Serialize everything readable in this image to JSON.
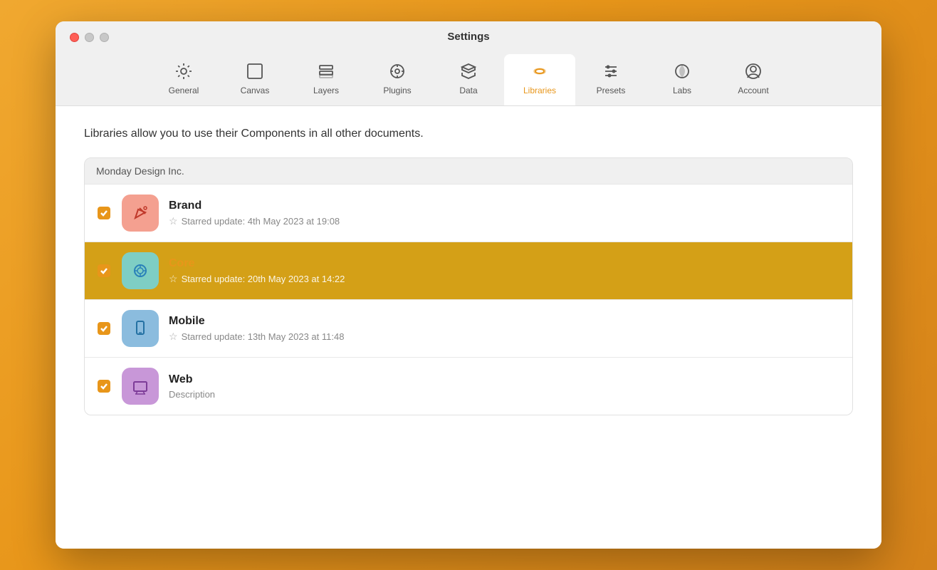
{
  "window": {
    "title": "Settings"
  },
  "nav": {
    "tabs": [
      {
        "id": "general",
        "label": "General",
        "icon": "gear"
      },
      {
        "id": "canvas",
        "label": "Canvas",
        "icon": "canvas"
      },
      {
        "id": "layers",
        "label": "Layers",
        "icon": "layers"
      },
      {
        "id": "plugins",
        "label": "Plugins",
        "icon": "plugins"
      },
      {
        "id": "data",
        "label": "Data",
        "icon": "data"
      },
      {
        "id": "libraries",
        "label": "Libraries",
        "icon": "libraries",
        "active": true
      },
      {
        "id": "presets",
        "label": "Presets",
        "icon": "presets"
      },
      {
        "id": "labs",
        "label": "Labs",
        "icon": "labs"
      },
      {
        "id": "account",
        "label": "Account",
        "icon": "account"
      }
    ]
  },
  "content": {
    "description": "Libraries allow you to use their Components in all other documents.",
    "section_header": "Monday Design Inc.",
    "libraries": [
      {
        "id": "brand",
        "title": "Brand",
        "subtitle": "Starred update: 4th May 2023 at 19:08",
        "icon_bg": "#f4a090",
        "icon_color": "#c0392b",
        "checked": true,
        "highlighted": false
      },
      {
        "id": "core",
        "title": "Core",
        "subtitle": "Starred update: 20th May 2023 at 14:22",
        "icon_bg": "#7ecec4",
        "icon_color": "#2980b9",
        "checked": true,
        "highlighted": true
      },
      {
        "id": "mobile",
        "title": "Mobile",
        "subtitle": "Starred update: 13th May 2023 at 11:48",
        "icon_bg": "#8bbcde",
        "icon_color": "#2471a3",
        "checked": true,
        "highlighted": false
      },
      {
        "id": "web",
        "title": "Web",
        "subtitle": "Description",
        "icon_bg": "#c897d8",
        "icon_color": "#7d3c98",
        "checked": true,
        "highlighted": false
      }
    ]
  },
  "colors": {
    "accent": "#e8961a",
    "active_tab_bg": "#ffffff"
  }
}
